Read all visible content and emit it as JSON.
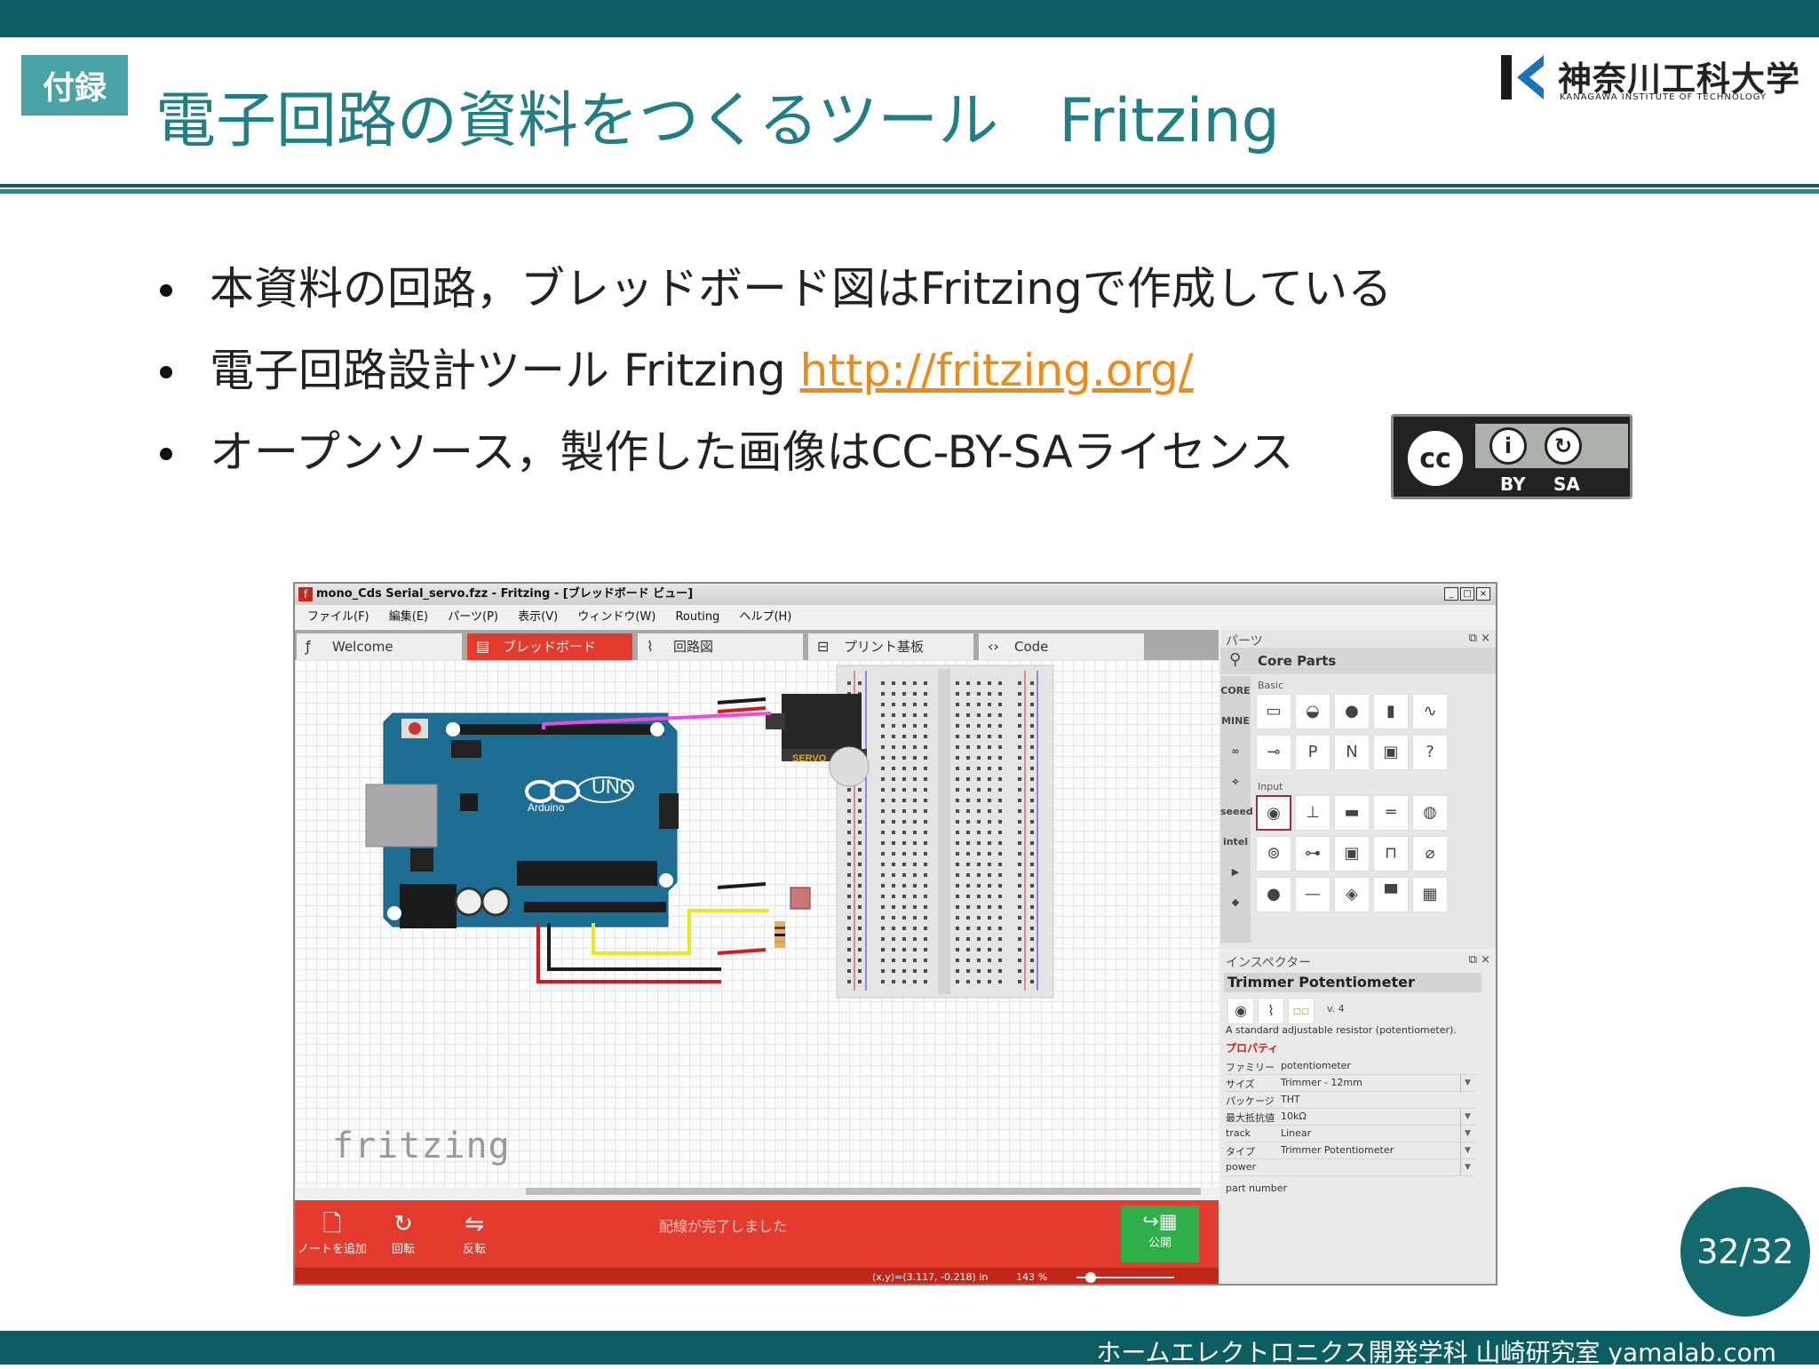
{
  "slide": {
    "tag": "付録",
    "title": "電子回路の資料をつくるツール　Fritzing",
    "logo": {
      "name": "神奈川工科大学",
      "sub": "KANAGAWA INSTITUTE OF TECHNOLOGY"
    },
    "bullets": [
      {
        "text": "本資料の回路，ブレッドボード図はFritzingで作成している",
        "link": ""
      },
      {
        "text": "電子回路設計ツール Fritzing ",
        "link": "http://fritzing.org/"
      },
      {
        "text": "オープンソース，製作した画像はCC-BY-SAライセンス",
        "link": ""
      }
    ],
    "cc": {
      "cc": "cc",
      "by": "BY",
      "sa": "SA"
    },
    "page": "32/32",
    "footer": "ホームエレクトロニクス開発学科 山崎研究室 yamalab.com",
    "colors": {
      "teal": "#0b5d61",
      "accent": "#1f7f84",
      "link": "#e88d1c",
      "fritzing_red": "#e33b2e"
    }
  },
  "app": {
    "window_title": "mono_Cds Serial_servo.fzz - Fritzing - [ブレッドボード ビュー]",
    "window_controls": [
      "_",
      "□",
      "×"
    ],
    "menu": [
      "ファイル(F)",
      "編集(E)",
      "パーツ(P)",
      "表示(V)",
      "ウィンドウ(W)",
      "Routing",
      "ヘルプ(H)"
    ],
    "tabs": [
      {
        "label": "Welcome",
        "icon": "fritzing-f-icon"
      },
      {
        "label": "ブレッドボード",
        "icon": "breadboard-icon"
      },
      {
        "label": "回路図",
        "icon": "schematic-icon"
      },
      {
        "label": "プリント基板",
        "icon": "pcb-icon"
      },
      {
        "label": "Code",
        "icon": "code-icon"
      }
    ],
    "canvas": {
      "watermark": "fritzing",
      "board_label": "UNO",
      "board_brand": "Arduino",
      "servo_label": "SERVO"
    },
    "bottom": {
      "add_note": "ノートを追加",
      "rotate": "回転",
      "flip": "反転",
      "routing_status": "配線が完了しました",
      "publish": "公開"
    },
    "status": {
      "coords": "(x,y)=(3.117, -0.218) in",
      "zoom": "143 %"
    },
    "parts_panel": {
      "title": "パーツ",
      "bin_title": "Core Parts",
      "bin_tabs": [
        "CORE",
        "MINE",
        "∞",
        "⟡",
        "seeed",
        "intel",
        "▶",
        "◆"
      ],
      "section_basic": "Basic",
      "section_input": "Input"
    },
    "inspector": {
      "title": "インスペクター",
      "part_name": "Trimmer Potentiometer",
      "version": "v. 4",
      "description": "A standard adjustable resistor (potentiometer).",
      "properties_label": "プロパティ",
      "properties": [
        {
          "key": "ファミリー",
          "value": "potentiometer"
        },
        {
          "key": "サイズ",
          "value": "Trimmer - 12mm"
        },
        {
          "key": "パッケージ",
          "value": "THT"
        },
        {
          "key": "最大抵抗値",
          "value": "10kΩ"
        },
        {
          "key": "track",
          "value": "Linear"
        },
        {
          "key": "タイプ",
          "value": "Trimmer Potentiometer"
        },
        {
          "key": "power",
          "value": ""
        },
        {
          "key": "part number",
          "value": ""
        }
      ]
    }
  }
}
